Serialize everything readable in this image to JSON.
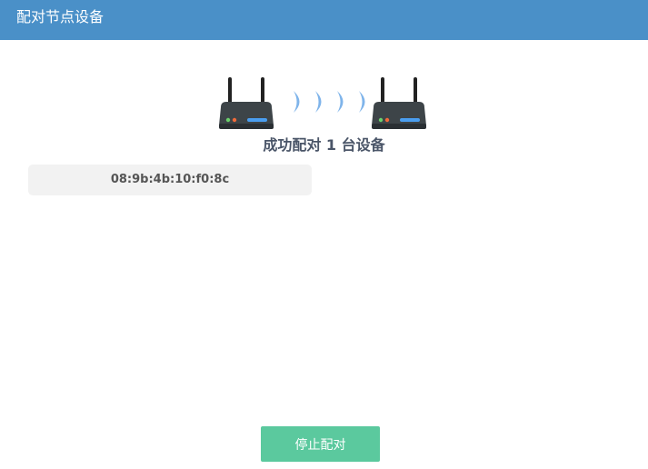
{
  "header": {
    "title": "配对节点设备"
  },
  "illustration": {
    "left_device_icon": "router-icon",
    "right_device_icon": "router-icon",
    "signal_icon": "wireless-signal-wave-icon"
  },
  "status": {
    "text": "成功配对 1 台设备"
  },
  "devices": [
    {
      "mac": "08:9b:4b:10:f0:8c"
    }
  ],
  "actions": {
    "stop_label": "停止配对"
  },
  "colors": {
    "header_bg": "#4a90c8",
    "button_bg": "#5bc99e",
    "status_text": "#4a5568",
    "device_item_bg": "#f2f2f2"
  }
}
